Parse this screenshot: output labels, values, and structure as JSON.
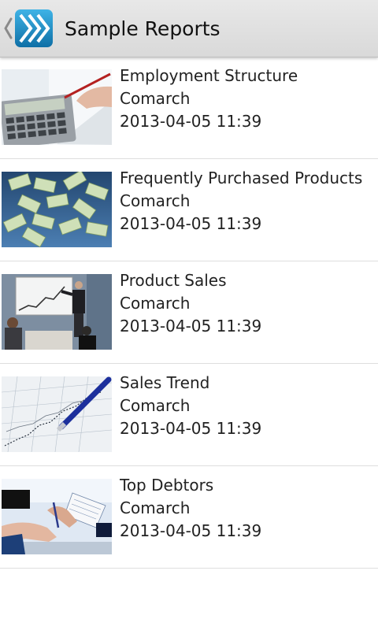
{
  "actionbar": {
    "title": "Sample Reports",
    "up_icon": "back-chevron-icon",
    "logo_icon": "app-logo-icon"
  },
  "reports": [
    {
      "title": "Employment Structure",
      "author": "Comarch",
      "date": "2013-04-05 11:39",
      "thumb": "calculator-image"
    },
    {
      "title": "Frequently Purchased Products",
      "author": "Comarch",
      "date": "2013-04-05 11:39",
      "thumb": "money-image"
    },
    {
      "title": "Product Sales",
      "author": "Comarch",
      "date": "2013-04-05 11:39",
      "thumb": "presentation-image"
    },
    {
      "title": "Sales Trend",
      "author": "Comarch",
      "date": "2013-04-05 11:39",
      "thumb": "chart-pen-image"
    },
    {
      "title": "Top Debtors",
      "author": "Comarch",
      "date": "2013-04-05 11:39",
      "thumb": "handshake-image"
    }
  ],
  "colors": {
    "actionbar_bg": "#dcdcdc",
    "logo_blue": "#1a8fc9",
    "text": "#222222",
    "divider": "#dedede"
  }
}
